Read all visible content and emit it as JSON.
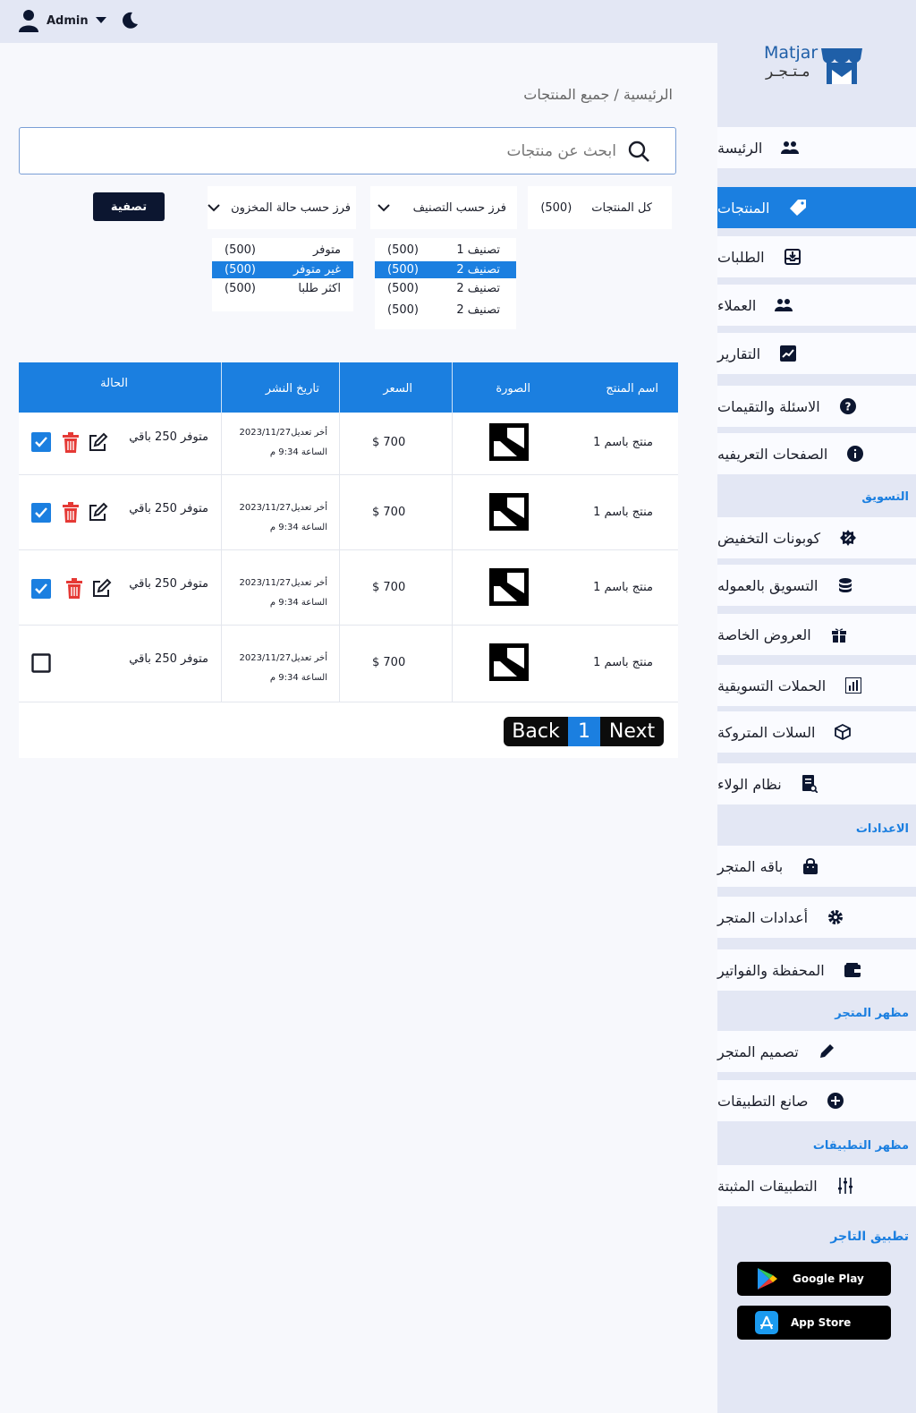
{
  "header": {
    "admin_label": "Admin"
  },
  "brand": {
    "name_en": "Matjar",
    "name_ar": "مـتـجـر"
  },
  "sidebar": {
    "items": [
      {
        "label": "الرئيسة",
        "icon": "users-icon"
      },
      {
        "label": "المنتجات",
        "icon": "tag-icon"
      },
      {
        "label": "الطلبات",
        "icon": "inbox-download-icon"
      },
      {
        "label": "العملاء",
        "icon": "users-icon"
      },
      {
        "label": "التقارير",
        "icon": "chart-line-icon"
      },
      {
        "label": "الاسئلة والتقيمات",
        "icon": "question-icon"
      },
      {
        "label": "الصفحات التعريفيه",
        "icon": "info-icon"
      },
      {
        "label": "كوبونات التخفيض",
        "icon": "discount-badge-icon"
      },
      {
        "label": "التسويق بالعموله",
        "icon": "coins-icon"
      },
      {
        "label": "العروض الخاصة",
        "icon": "gift-icon"
      },
      {
        "label": "الحملات التسويقية",
        "icon": "bar-chart-icon"
      },
      {
        "label": "السلات المتروكة",
        "icon": "box-icon"
      },
      {
        "label": "نظام الولاء",
        "icon": "document-search-icon"
      },
      {
        "label": "باقه المتجر",
        "icon": "shopping-bag-icon"
      },
      {
        "label": "أعدادات المتجر",
        "icon": "gear-icon"
      },
      {
        "label": "المحفظة والفواتير",
        "icon": "wallet-icon"
      },
      {
        "label": "تصميم المتجر",
        "icon": "pencil-icon"
      },
      {
        "label": "صانع التطبيقات",
        "icon": "plus-circle-icon"
      },
      {
        "label": "التطبيقات المثبتة",
        "icon": "sliders-icon"
      }
    ],
    "sections": {
      "marketing": "التسويق",
      "settings": "الاعدادات",
      "store_look": "مظهر المتجر",
      "apps_look": "مظهر التطبيقات",
      "merchant_app": "تطبيق التاجر"
    },
    "google_play": "Google Play",
    "app_store": "App Store"
  },
  "breadcrumb": "الرئيسية /  جميع  المنتجات",
  "search": {
    "placeholder": "ابحث عن منتجات"
  },
  "filters": {
    "all_products": "كل المنتجات",
    "all_count": "(500)",
    "sort_category": "فرز حسب  التصنيف",
    "sort_stock": "فرز حسب حالة المخزون",
    "apply": "تصفية"
  },
  "stock_options": [
    {
      "label": "متوفر",
      "count": "(500)"
    },
    {
      "label": "غير متوفر",
      "count": "(500)"
    },
    {
      "label": "اكثر طلبا",
      "count": "(500)"
    }
  ],
  "category_options": [
    {
      "label": "تصنيف 1",
      "count": "(500)"
    },
    {
      "label": "تصنيف 2",
      "count": "(500)"
    },
    {
      "label": "تصنيف 2",
      "count": "(500)"
    },
    {
      "label": "تصنيف 2",
      "count": "(500)"
    }
  ],
  "table": {
    "headers": {
      "name": "اسم المنتج",
      "image": "الصورة",
      "price": "السعر",
      "date": "تاريخ النشر",
      "status": "الحالة"
    },
    "rows": [
      {
        "name": "منتج باسم 1",
        "price": "700 $",
        "date1": "أخر تعديل2023/11/27",
        "date2": "الساعة 9:34 م",
        "status": "متوفر 250 باقي",
        "checked": true
      },
      {
        "name": "منتج باسم 1",
        "price": "700 $",
        "date1": "أخر تعديل2023/11/27",
        "date2": "الساعة 9:34 م",
        "status": "متوفر 250 باقي",
        "checked": true
      },
      {
        "name": "منتج باسم 1",
        "price": "700 $",
        "date1": "أخر تعديل2023/11/27",
        "date2": "الساعة 9:34 م",
        "status": "متوفر 250 باقي",
        "checked": true
      },
      {
        "name": "منتج باسم 1",
        "price": "700 $",
        "date1": "أخر تعديل2023/11/27",
        "date2": "الساعة 9:34 م",
        "status": "متوفر 250 باقي",
        "checked": false
      }
    ]
  },
  "pagination": {
    "back": "Back",
    "page": "1",
    "next": "Next"
  },
  "colors": {
    "accent": "#1b7fe0",
    "danger": "#e53935",
    "dark": "#0c1630"
  }
}
